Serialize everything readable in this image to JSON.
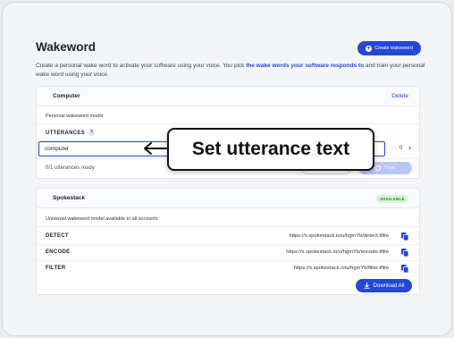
{
  "page": {
    "title": "Wakeword",
    "create_button": "Create wakeword",
    "description_before": "Create a personal wake word to activate your software using your voice. You pick ",
    "description_link": "the wake words your software responds to",
    "description_after": " and train your personal wake word using your voice."
  },
  "personal_card": {
    "title": "Computer",
    "delete_label": "Delete",
    "subtitle": "Personal wakeword model",
    "utterances_label": "UTTERANCES",
    "help_glyph": "?",
    "input_value": "computer",
    "counter": "0",
    "status": "0/1 utterances ready",
    "train_label": "Train"
  },
  "shared_card": {
    "title": "Spokestack",
    "badge": "AVAILABLE",
    "subtitle": "Universal wakeword model available to all accounts",
    "models": [
      {
        "label": "DETECT",
        "url": "https://s.spokestack.io/u/hgmYb/detect.tflite"
      },
      {
        "label": "ENCODE",
        "url": "https://s.spokestack.io/u/hgmYb/encode.tflite"
      },
      {
        "label": "FILTER",
        "url": "https://s.spokestack.io/u/hgmYb/filter.tflite"
      }
    ],
    "download_label": "Download All"
  },
  "callout": {
    "text": "Set utterance text"
  },
  "colors": {
    "accent": "#2547d8",
    "badge_bg": "#d6f5d6",
    "badge_text": "#1d7a2e",
    "train_disabled": "#b9c6f3"
  }
}
